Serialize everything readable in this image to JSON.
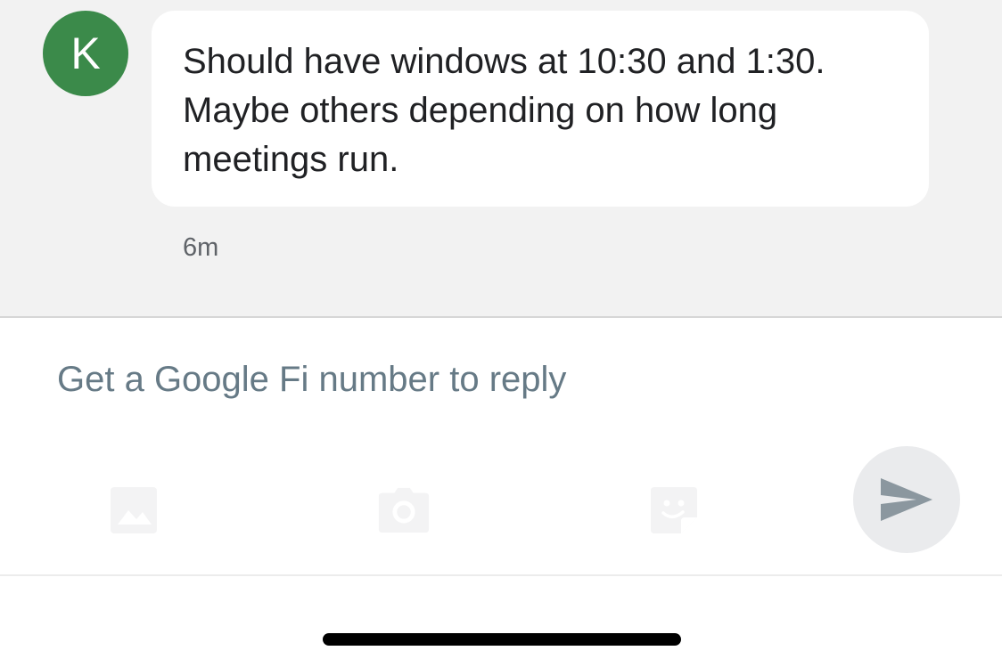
{
  "conversation": {
    "sender_initial": "K",
    "avatar_color": "#3b8a4a",
    "messages": [
      {
        "text": "Should have windows at 10:30 and 1:30. Maybe others depending on how long meetings run.",
        "timestamp": "6m"
      }
    ]
  },
  "composer": {
    "prompt_text": "Get a Google Fi number to reply",
    "icons": [
      "gallery-icon",
      "camera-icon",
      "sticker-icon",
      "send-icon"
    ]
  },
  "colors": {
    "thread_background": "#f2f2f2",
    "bubble_background": "#ffffff",
    "send_button_background": "#eaebed",
    "send_icon": "#8b979f",
    "disabled_icon": "#f3f3f4"
  }
}
